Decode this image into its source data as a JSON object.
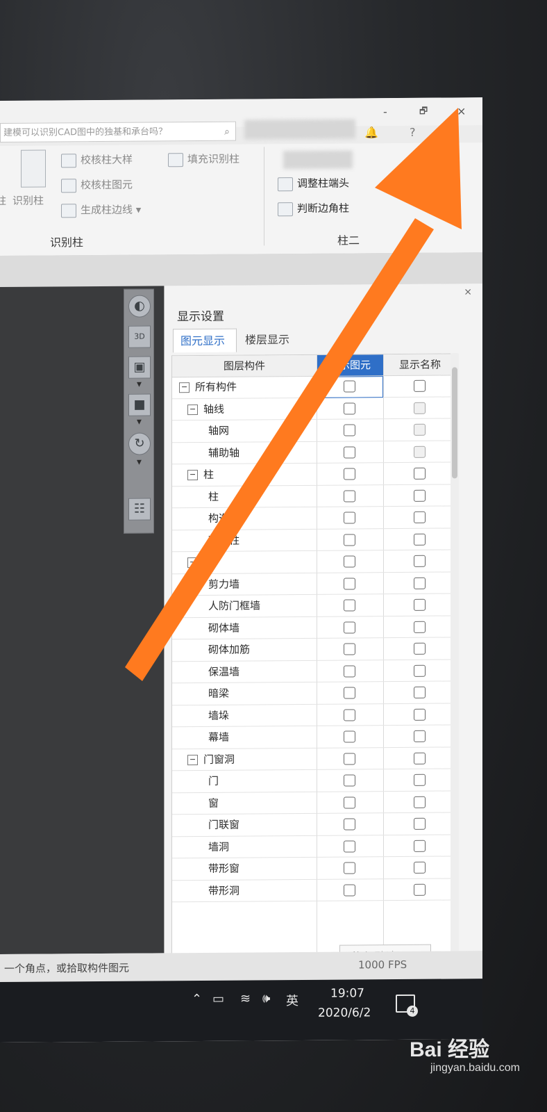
{
  "window": {
    "search_placeholder": "建模可以识别CAD图中的独基和承台吗？",
    "controls": {
      "minimize": "-",
      "restore": "🗗",
      "close": "×"
    }
  },
  "ribbon": {
    "check_column_size": "校核柱大样",
    "fill_identify_column": "填充识别柱",
    "check_column_element": "校核柱图元",
    "generate_column_edge": "生成柱边线",
    "identify_column_big": "识别柱",
    "left_partial": "柱",
    "group_identify_column": "识别柱",
    "adjust_column_end": "调整柱端头",
    "judge_corner_column": "判断边角柱",
    "group_column_two": "柱二"
  },
  "panel": {
    "title": "显示设置",
    "tabs": [
      "图元显示",
      "楼层显示"
    ],
    "headers": {
      "layer": "图层构件",
      "show_element": "显示图元",
      "show_name": "显示名称"
    },
    "rows": [
      {
        "label": "所有构件",
        "expander": "−"
      },
      {
        "label": "轴线",
        "expander": "−"
      },
      {
        "label": "轴网"
      },
      {
        "label": "辅助轴"
      },
      {
        "label": "柱",
        "expander": "−"
      },
      {
        "label": "柱"
      },
      {
        "label": "构造柱"
      },
      {
        "label": "砌体柱"
      },
      {
        "label": "墙",
        "expander": "−"
      },
      {
        "label": "剪力墙"
      },
      {
        "label": "人防门框墙"
      },
      {
        "label": "砌体墙"
      },
      {
        "label": "砌体加筋"
      },
      {
        "label": "保温墙"
      },
      {
        "label": "暗梁"
      },
      {
        "label": "墙垛"
      },
      {
        "label": "幕墙"
      },
      {
        "label": "门窗洞",
        "expander": "−"
      },
      {
        "label": "门"
      },
      {
        "label": "窗"
      },
      {
        "label": "门联窗"
      },
      {
        "label": "墙洞"
      },
      {
        "label": "带形窗"
      },
      {
        "label": "带形洞"
      }
    ],
    "restore_button": "恢复默认设置",
    "close": "×"
  },
  "statusbar": {
    "hint": "一个角点，或拾取构件图元",
    "fps": "1000 FPS"
  },
  "taskbar": {
    "ime": "英",
    "time": "19:07",
    "date": "2020/6/2",
    "notification_count": "4"
  },
  "watermark": {
    "logo": "Bai 经验",
    "site": "jingyan.baidu.com"
  },
  "colors": {
    "arrow": "#ff7a1f",
    "selection": "#2f6fc7"
  }
}
